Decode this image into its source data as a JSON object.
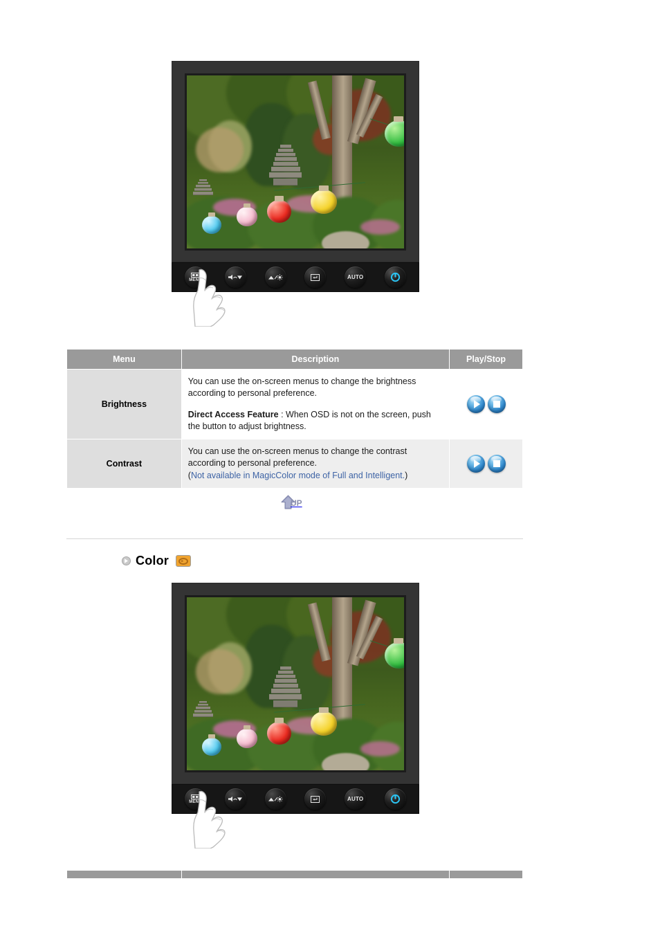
{
  "document": {
    "kind": "monitor-user-manual-page"
  },
  "illustrations": [
    {
      "name": "brightness-contrast-monitor",
      "alt": "LCD monitor displaying a Korean garden photo with stone pagodas and colored paper lanterns; a hand presses the MENU button",
      "buttons": [
        {
          "id": "menu",
          "label": "MENU",
          "icon": "osd-menu-icon"
        },
        {
          "id": "down",
          "label": "",
          "icon": "volume-down-arrow-icon"
        },
        {
          "id": "brightness",
          "label": "",
          "icon": "brightness-up-icon"
        },
        {
          "id": "enter",
          "label": "",
          "icon": "enter-icon"
        },
        {
          "id": "auto",
          "label": "AUTO",
          "icon": "auto-adjust-icon"
        },
        {
          "id": "power",
          "label": "",
          "icon": "power-icon"
        }
      ]
    },
    {
      "name": "color-monitor",
      "alt": "LCD monitor displaying a Korean garden photo with stone pagodas and colored paper lanterns; a hand presses the MENU button",
      "buttons": [
        {
          "id": "menu",
          "label": "MENU",
          "icon": "osd-menu-icon"
        },
        {
          "id": "down",
          "label": "",
          "icon": "volume-down-arrow-icon"
        },
        {
          "id": "brightness",
          "label": "",
          "icon": "brightness-up-icon"
        },
        {
          "id": "enter",
          "label": "",
          "icon": "enter-icon"
        },
        {
          "id": "auto",
          "label": "AUTO",
          "icon": "auto-adjust-icon"
        },
        {
          "id": "power",
          "label": "",
          "icon": "power-icon"
        }
      ]
    }
  ],
  "table": {
    "headers": {
      "menu": "Menu",
      "description": "Description",
      "play_stop": "Play/Stop"
    },
    "rows": [
      {
        "menu": "Brightness",
        "paragraph1": "You can use the on-screen menus to change the brightness according to personal preference.",
        "paragraph2_bold": "Direct Access Feature",
        "paragraph2_rest": " : When OSD is not on the screen, push the button to adjust brightness.",
        "note_prefix": "",
        "note_link": "",
        "note_suffix": "",
        "play_label": "play-button",
        "stop_label": "stop-button"
      },
      {
        "menu": "Contrast",
        "paragraph1": "You can use the on-screen menus to change the contrast according to personal preference.",
        "paragraph2_bold": "",
        "paragraph2_rest": "",
        "note_prefix": "(",
        "note_link": "Not available in MagicColor mode of Full and Intelligent.",
        "note_suffix": ")",
        "play_label": "play-button",
        "stop_label": "stop-button"
      }
    ]
  },
  "up_link": {
    "label": "UP",
    "icon": "up-arrow-icon"
  },
  "color_section": {
    "title": "Color",
    "bullet_icon": "circle-arrow-bullet-icon",
    "chip_icon": "color-palette-icon"
  },
  "colors": {
    "table_header_bg": "#9a9a9a",
    "menu_cell_bg": "#dedede",
    "alt_row_bg": "#eeeeee",
    "note_link": "#3d63a5",
    "monitor_bezel": "#343434",
    "button_strip": "#161616",
    "power_led": "#2bc4f3",
    "color_chip": "#f0a430",
    "up_arrow": "#8b8fae",
    "play_button": "#2f87cc"
  }
}
